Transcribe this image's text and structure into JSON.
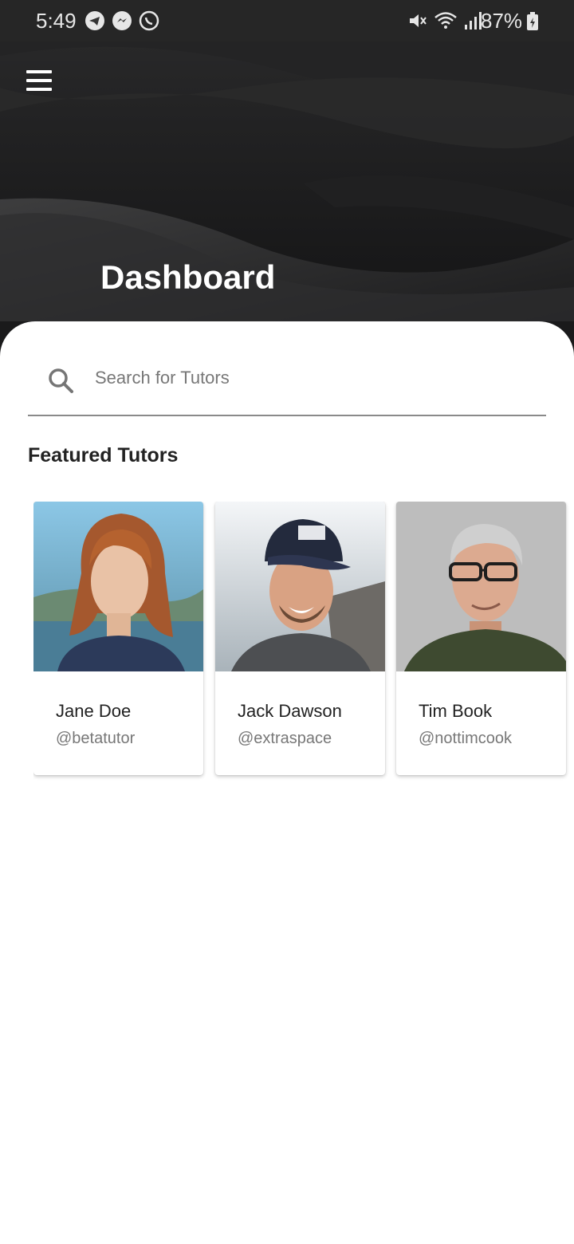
{
  "status_bar": {
    "time": "5:49",
    "battery": "87%",
    "left_icons": [
      "telegram-icon",
      "messenger-icon",
      "whatsapp-icon"
    ],
    "right_icons": [
      "mute-icon",
      "wifi-icon",
      "signal-icon",
      "battery-icon"
    ]
  },
  "header": {
    "title": "Dashboard",
    "menu_icon": "hamburger-menu-icon"
  },
  "search": {
    "placeholder": "Search for Tutors",
    "value": ""
  },
  "featured": {
    "title": "Featured Tutors",
    "tutors": [
      {
        "name": "Jane Doe",
        "handle": "@betatutor"
      },
      {
        "name": "Jack Dawson",
        "handle": "@extraspace"
      },
      {
        "name": "Tim Book",
        "handle": "@nottimcook"
      }
    ]
  },
  "colors": {
    "header_bg": "#1a1a1b",
    "title_text": "#ffffff",
    "body_text": "#222222",
    "muted_text": "#777777"
  }
}
